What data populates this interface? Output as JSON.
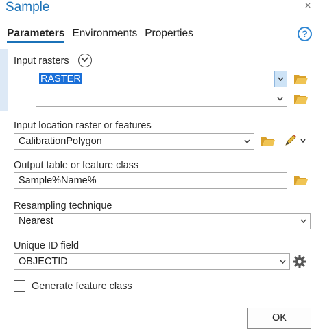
{
  "window": {
    "title": "Sample",
    "close_glyph": "×"
  },
  "tabs": [
    {
      "label": "Parameters",
      "active": true
    },
    {
      "label": "Environments",
      "active": false
    },
    {
      "label": "Properties",
      "active": false
    }
  ],
  "help_glyph": "?",
  "input_rasters": {
    "label": "Input rasters",
    "rows": [
      {
        "value": "RASTER",
        "selected": true
      },
      {
        "value": "",
        "selected": false
      }
    ]
  },
  "input_location": {
    "label": "Input location raster or features",
    "value": "CalibrationPolygon"
  },
  "output_table": {
    "label": "Output table or feature class",
    "value": "Sample%Name%"
  },
  "resampling": {
    "label": "Resampling technique",
    "value": "Nearest"
  },
  "unique_id": {
    "label": "Unique ID field",
    "value": "OBJECTID"
  },
  "generate_feature": {
    "label": "Generate feature class",
    "checked": false
  },
  "ok_button": {
    "label": "OK"
  },
  "colors": {
    "accent": "#1b72b8",
    "folder": "#e6b83b",
    "selection": "#1a6fd8"
  },
  "icons": [
    "close-icon",
    "help-icon",
    "expand-circle-icon",
    "folder-icon",
    "pencil-icon",
    "chevron-down-icon",
    "gear-icon"
  ]
}
